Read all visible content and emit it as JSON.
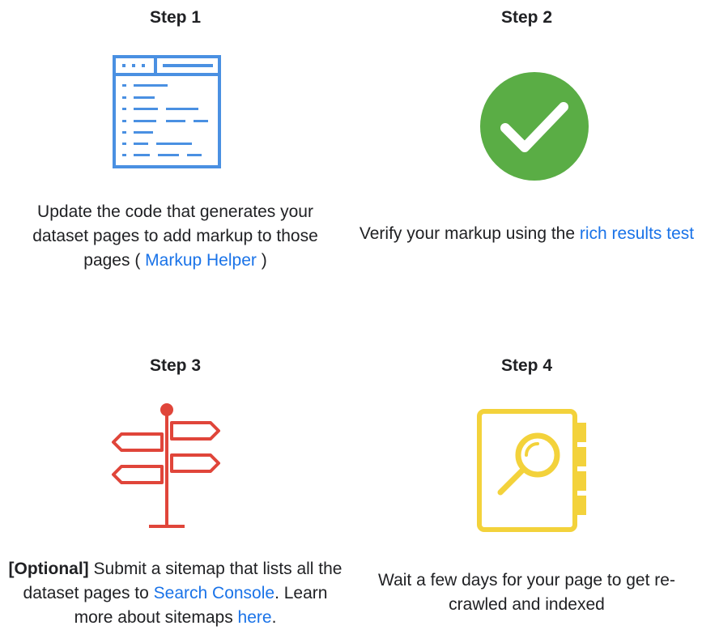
{
  "steps": [
    {
      "title": "Step 1",
      "icon": "code-editor-icon",
      "text_before": "Update the code that generates your dataset pages to add markup to those pages ( ",
      "link": "Markup Helper",
      "text_after": " )"
    },
    {
      "title": "Step 2",
      "icon": "check-circle-icon",
      "text_before": "Verify your markup using the ",
      "link": "rich results test",
      "text_after": ""
    },
    {
      "title": "Step 3",
      "icon": "signpost-icon",
      "bold_prefix": "[Optional]",
      "text_before": " Submit a sitemap that lists all the dataset pages to ",
      "link": "Search Console",
      "text_middle": ". Learn more about sitemaps ",
      "link2": "here",
      "text_after": "."
    },
    {
      "title": "Step 4",
      "icon": "search-notebook-icon",
      "text_before": "Wait a few days for your page to get re-crawled and indexed"
    }
  ],
  "colors": {
    "blue_icon": "#4a90e2",
    "green_check": "#5aad45",
    "red_signpost": "#e0453a",
    "yellow_notebook": "#f3d23b",
    "link": "#1a73e8"
  }
}
